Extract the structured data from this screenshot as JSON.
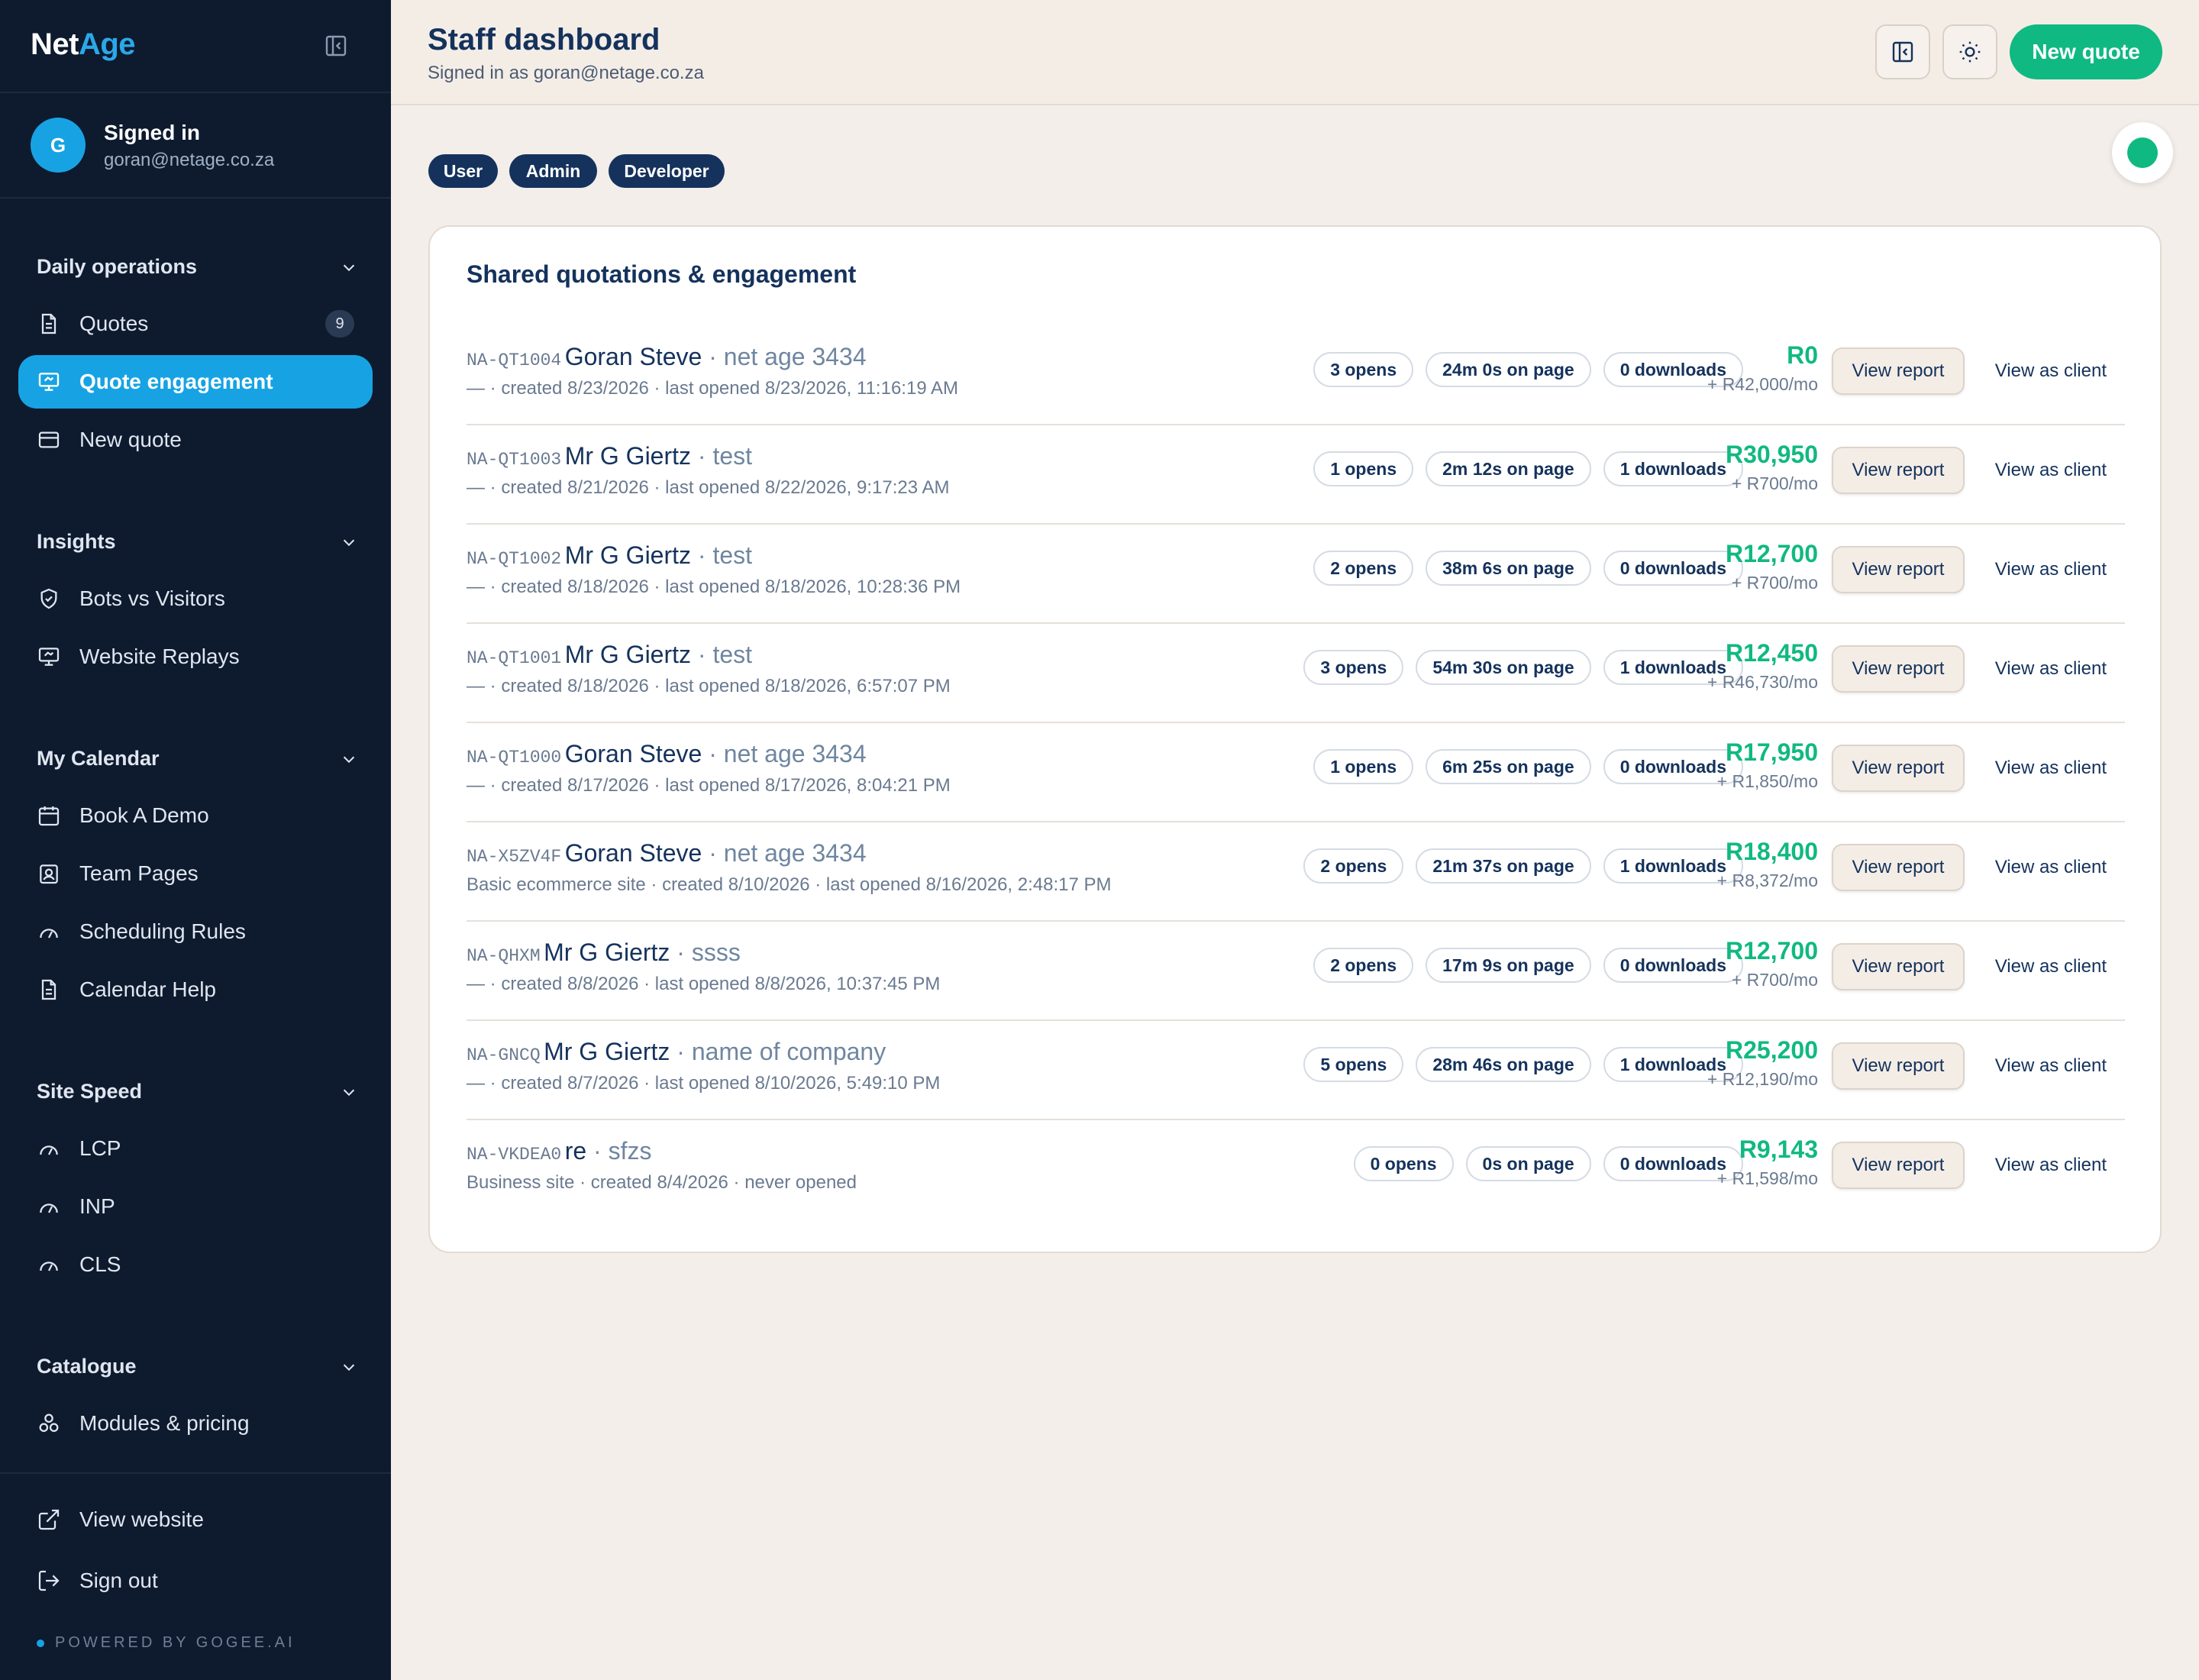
{
  "brand": {
    "part1": "Net",
    "part2": "Age"
  },
  "user": {
    "initial": "G",
    "status": "Signed in",
    "email": "goran@netage.co.za"
  },
  "sections": [
    {
      "title": "Daily operations",
      "items": [
        {
          "label": "Quotes",
          "icon": "document-icon",
          "badge": "9"
        },
        {
          "label": "Quote engagement",
          "icon": "monitor-icon",
          "active": true
        },
        {
          "label": "New quote",
          "icon": "card-icon"
        }
      ]
    },
    {
      "title": "Insights",
      "items": [
        {
          "label": "Bots vs Visitors",
          "icon": "shield-icon"
        },
        {
          "label": "Website Replays",
          "icon": "monitor-icon"
        }
      ]
    },
    {
      "title": "My Calendar",
      "items": [
        {
          "label": "Book A Demo",
          "icon": "calendar-icon"
        },
        {
          "label": "Team Pages",
          "icon": "badge-icon"
        },
        {
          "label": "Scheduling Rules",
          "icon": "gauge-icon"
        },
        {
          "label": "Calendar Help",
          "icon": "document-icon"
        }
      ]
    },
    {
      "title": "Site Speed",
      "items": [
        {
          "label": "LCP",
          "icon": "gauge-icon"
        },
        {
          "label": "INP",
          "icon": "gauge-icon"
        },
        {
          "label": "CLS",
          "icon": "gauge-icon"
        }
      ]
    },
    {
      "title": "Catalogue",
      "items": [
        {
          "label": "Modules & pricing",
          "icon": "modules-icon"
        }
      ]
    }
  ],
  "footer": {
    "view_website": "View website",
    "sign_out": "Sign out",
    "powered": "POWERED BY GOGEE.AI"
  },
  "header": {
    "title": "Staff dashboard",
    "subtitle": "Signed in as goran@netage.co.za",
    "new_quote": "New quote"
  },
  "roles": [
    "User",
    "Admin",
    "Developer"
  ],
  "card": {
    "title": "Shared quotations & engagement",
    "view_report": "View report",
    "view_client": "View as client",
    "rows": [
      {
        "id": "NA-QT1004",
        "client": "Goran Steve",
        "company": " · net age 3434",
        "meta": "— · created 8/23/2026 · last opened 8/23/2026, 11:16:19 AM",
        "opens": "3 opens",
        "time": "24m 0s on page",
        "downloads": "0 downloads",
        "price": "R0",
        "monthly": "+ R42,000/mo"
      },
      {
        "id": "NA-QT1003",
        "client": "Mr G Giertz",
        "company": " · test",
        "meta": "— · created 8/21/2026 · last opened 8/22/2026, 9:17:23 AM",
        "opens": "1 opens",
        "time": "2m 12s on page",
        "downloads": "1 downloads",
        "price": "R30,950",
        "monthly": "+ R700/mo"
      },
      {
        "id": "NA-QT1002",
        "client": "Mr G Giertz",
        "company": " · test",
        "meta": "— · created 8/18/2026 · last opened 8/18/2026, 10:28:36 PM",
        "opens": "2 opens",
        "time": "38m 6s on page",
        "downloads": "0 downloads",
        "price": "R12,700",
        "monthly": "+ R700/mo"
      },
      {
        "id": "NA-QT1001",
        "client": "Mr G Giertz",
        "company": " · test",
        "meta": "— · created 8/18/2026 · last opened 8/18/2026, 6:57:07 PM",
        "opens": "3 opens",
        "time": "54m 30s on page",
        "downloads": "1 downloads",
        "price": "R12,450",
        "monthly": "+ R46,730/mo"
      },
      {
        "id": "NA-QT1000",
        "client": "Goran Steve",
        "company": " · net age 3434",
        "meta": "— · created 8/17/2026 · last opened 8/17/2026, 8:04:21 PM",
        "opens": "1 opens",
        "time": "6m 25s on page",
        "downloads": "0 downloads",
        "price": "R17,950",
        "monthly": "+ R1,850/mo"
      },
      {
        "id": "NA-X5ZV4F",
        "client": "Goran Steve",
        "company": " · net age 3434",
        "meta": "Basic ecommerce site · created 8/10/2026 · last opened 8/16/2026, 2:48:17 PM",
        "opens": "2 opens",
        "time": "21m 37s on page",
        "downloads": "1 downloads",
        "price": "R18,400",
        "monthly": "+ R8,372/mo"
      },
      {
        "id": "NA-QHXM",
        "client": "Mr G Giertz",
        "company": " · ssss",
        "meta": "— · created 8/8/2026 · last opened 8/8/2026, 10:37:45 PM",
        "opens": "2 opens",
        "time": "17m 9s on page",
        "downloads": "0 downloads",
        "price": "R12,700",
        "monthly": "+ R700/mo"
      },
      {
        "id": "NA-GNCQ",
        "client": "Mr G Giertz",
        "company": " · name of company",
        "meta": "— · created 8/7/2026 · last opened 8/10/2026, 5:49:10 PM",
        "opens": "5 opens",
        "time": "28m 46s on page",
        "downloads": "1 downloads",
        "price": "R25,200",
        "monthly": "+ R12,190/mo"
      },
      {
        "id": "NA-VKDEA0",
        "client": "re",
        "company": " · sfzs",
        "meta": "Business site · created 8/4/2026 · never opened",
        "opens": "0 opens",
        "time": "0s on page",
        "downloads": "0 downloads",
        "price": "R9,143",
        "monthly": "+ R1,598/mo"
      }
    ]
  }
}
